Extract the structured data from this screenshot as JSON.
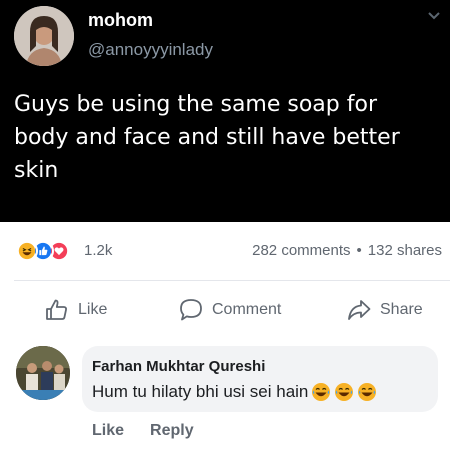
{
  "tweet": {
    "display_name": "mohom",
    "handle": "@annoyyyinlady",
    "text": "Guys be using the same soap for body and face and still have better skin",
    "avatar_icon": "profile-photo",
    "menu_icon": "chevron-down-icon"
  },
  "reactions": {
    "icons": [
      "haha-icon",
      "like-icon",
      "love-icon"
    ],
    "count": "1.2k"
  },
  "stats": {
    "comments": "282 comments",
    "separator": "•",
    "shares": "132 shares"
  },
  "actions": {
    "like_label": "Like",
    "comment_label": "Comment",
    "share_label": "Share"
  },
  "comment": {
    "author": "Farhan Mukhtar Qureshi",
    "text": "Hum tu hilaty bhi usi sei hain",
    "emoji": [
      "laughing-crying-emoji",
      "laughing-crying-emoji",
      "laughing-crying-emoji"
    ],
    "like_label": "Like",
    "reply_label": "Reply"
  },
  "colors": {
    "tweet_bg": "#000000",
    "meta_text": "#606770",
    "like_blue": "#1877f2",
    "love_red": "#f33e58",
    "haha_yellow": "#f7b125"
  }
}
